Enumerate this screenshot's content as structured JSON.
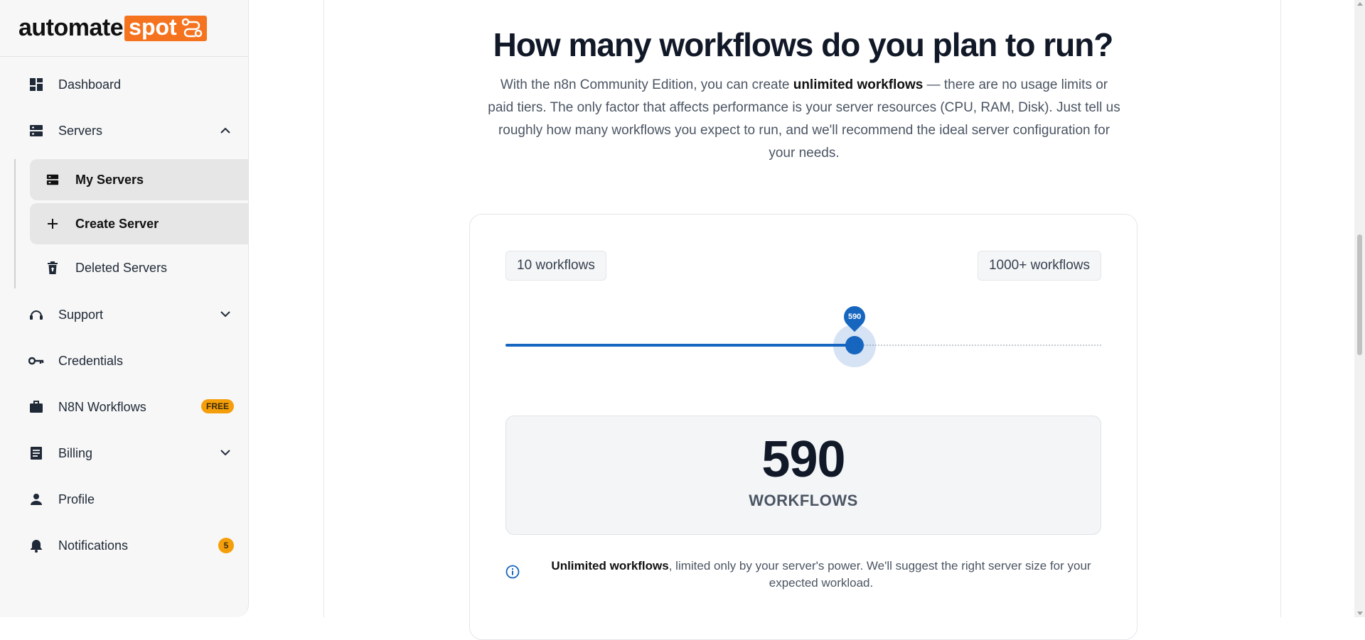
{
  "brand": {
    "name_part1": "automate",
    "name_part2": "spot",
    "accent": "#f5731f"
  },
  "sidebar": {
    "items": [
      {
        "label": "Dashboard",
        "icon": "dashboard-icon"
      },
      {
        "label": "Servers",
        "icon": "server-icon",
        "expanded": true
      },
      {
        "label": "Support",
        "icon": "support-icon"
      },
      {
        "label": "Credentials",
        "icon": "key-icon"
      },
      {
        "label": "N8N Workflows",
        "icon": "briefcase-icon",
        "badge": "FREE"
      },
      {
        "label": "Billing",
        "icon": "billing-icon"
      },
      {
        "label": "Profile",
        "icon": "person-icon"
      },
      {
        "label": "Notifications",
        "icon": "bell-icon",
        "badge": "5"
      }
    ],
    "servers_sub": [
      {
        "label": "My Servers",
        "icon": "server-icon",
        "active": true
      },
      {
        "label": "Create Server",
        "icon": "plus-icon",
        "active": true
      },
      {
        "label": "Deleted Servers",
        "icon": "trash-icon",
        "active": false
      }
    ]
  },
  "main": {
    "heading": "How many workflows do you plan to run?",
    "intro_pre": "With the n8n Community Edition, you can create ",
    "intro_bold": "unlimited workflows",
    "intro_post": " — there are no usage limits or paid tiers. The only factor that affects performance is your server resources (CPU, RAM, Disk). Just tell us roughly how many workflows you expect to run, and we'll recommend the ideal server configuration for your needs.",
    "slider": {
      "min_label": "10 workflows",
      "max_label": "1000+ workflows",
      "value": 590,
      "value_label": "590",
      "fraction": 0.586,
      "color": "#1666c0"
    },
    "result": {
      "number": "590",
      "unit": "WORKFLOWS"
    },
    "note": {
      "bold": "Unlimited workflows",
      "text": ", limited only by your server's power. We'll suggest the right server size for your expected workload."
    }
  }
}
